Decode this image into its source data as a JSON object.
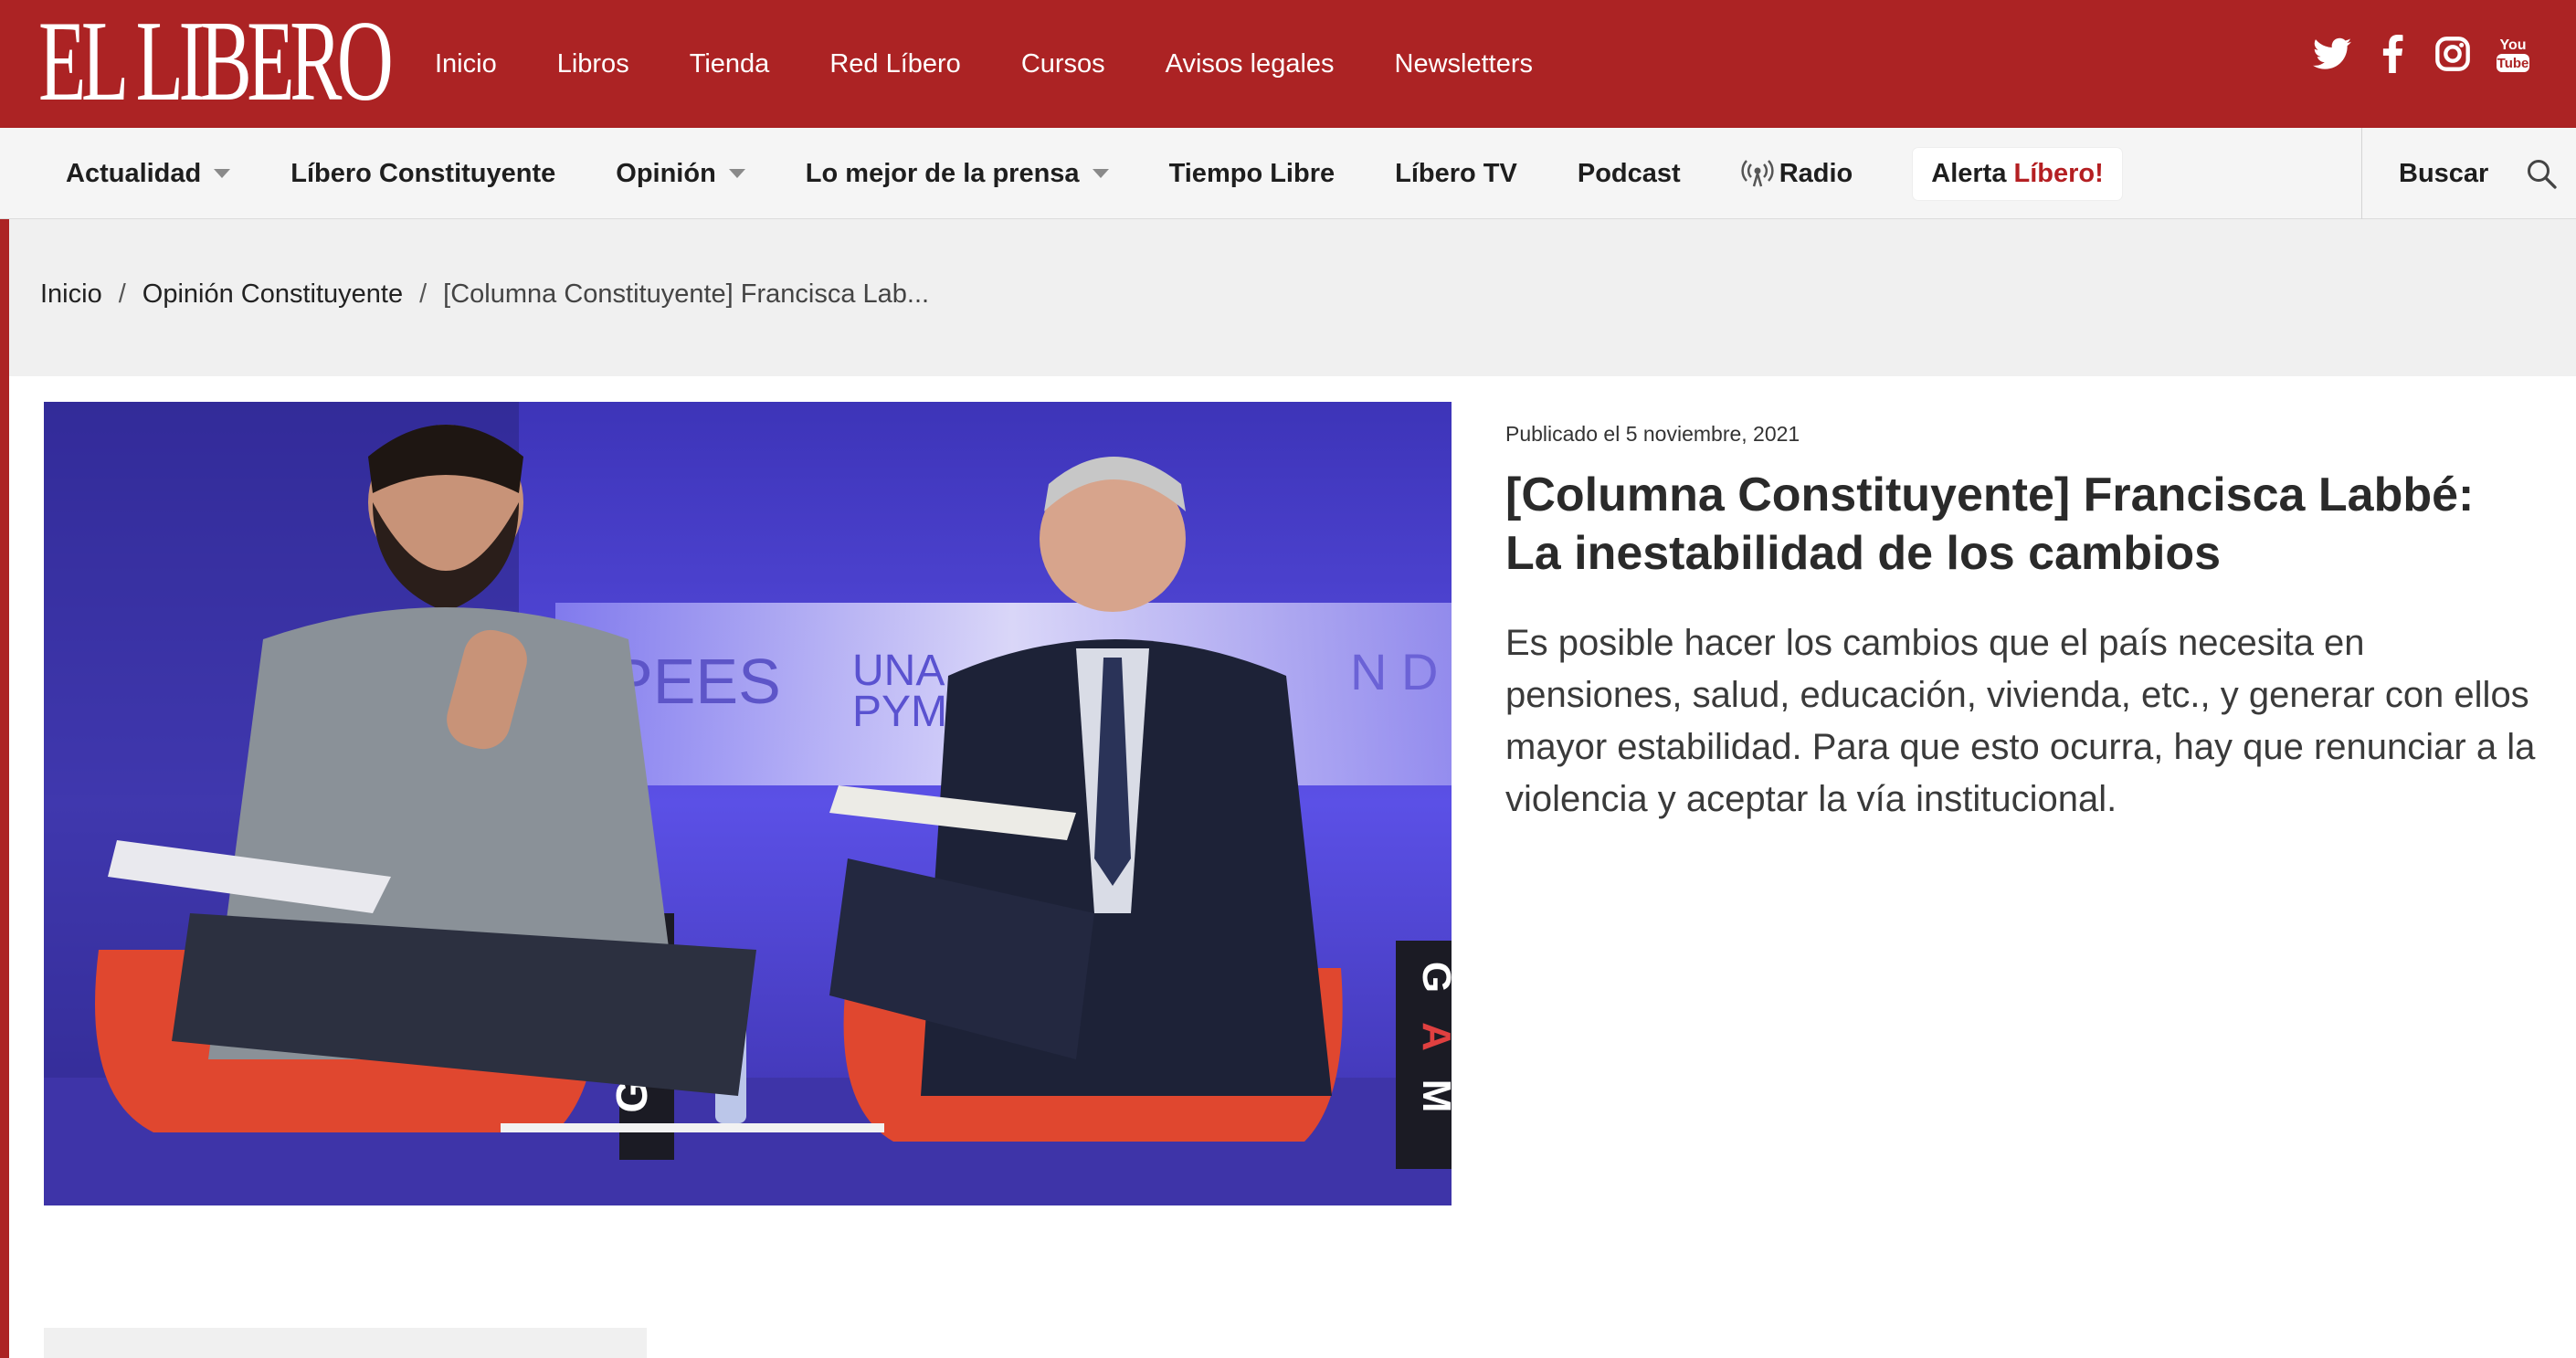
{
  "brand": {
    "logo_text": "EL LIBERO",
    "accent": "#ac2324"
  },
  "top_nav": [
    "Inicio",
    "Libros",
    "Tienda",
    "Red Líbero",
    "Cursos",
    "Avisos legales",
    "Newsletters"
  ],
  "social": {
    "icons": [
      "twitter-icon",
      "facebook-icon",
      "instagram-icon",
      "youtube-icon"
    ],
    "youtube_text_1": "You",
    "youtube_text_2": "Tube"
  },
  "sub_nav": {
    "items": [
      {
        "label": "Actualidad",
        "dropdown": true
      },
      {
        "label": "Líbero Constituyente",
        "dropdown": false
      },
      {
        "label": "Opinión",
        "dropdown": true
      },
      {
        "label": "Lo mejor de la prensa",
        "dropdown": true
      },
      {
        "label": "Tiempo Libre",
        "dropdown": false
      },
      {
        "label": "Líbero TV",
        "dropdown": false
      },
      {
        "label": "Podcast",
        "dropdown": false
      },
      {
        "label": "Radio",
        "dropdown": false,
        "icon": "radio-broadcast-icon"
      }
    ],
    "alerta_prefix": "Alerta",
    "alerta_highlight": "Líbero!",
    "search_label": "Buscar"
  },
  "breadcrumb": {
    "items": [
      "Inicio",
      "Opinión Constituyente",
      "[Columna Constituyente] Francisca Lab..."
    ],
    "separator": "/"
  },
  "hero": {
    "stage_logos": [
      "PEES",
      "UNA",
      "PYME",
      "N D",
      "G",
      "A",
      "M",
      "G",
      "A",
      "M"
    ]
  },
  "article": {
    "date": "Publicado el 5 noviembre, 2021",
    "title": "[Columna Constituyente] Francisca Labbé: La inestabilidad de los cambios",
    "lead": "Es posible hacer los cambios que el país necesita en pensiones, salud, educación, vivienda, etc., y generar con ellos mayor estabilidad. Para que esto ocurra, hay que renunciar a la violencia y aceptar la vía institucional."
  }
}
